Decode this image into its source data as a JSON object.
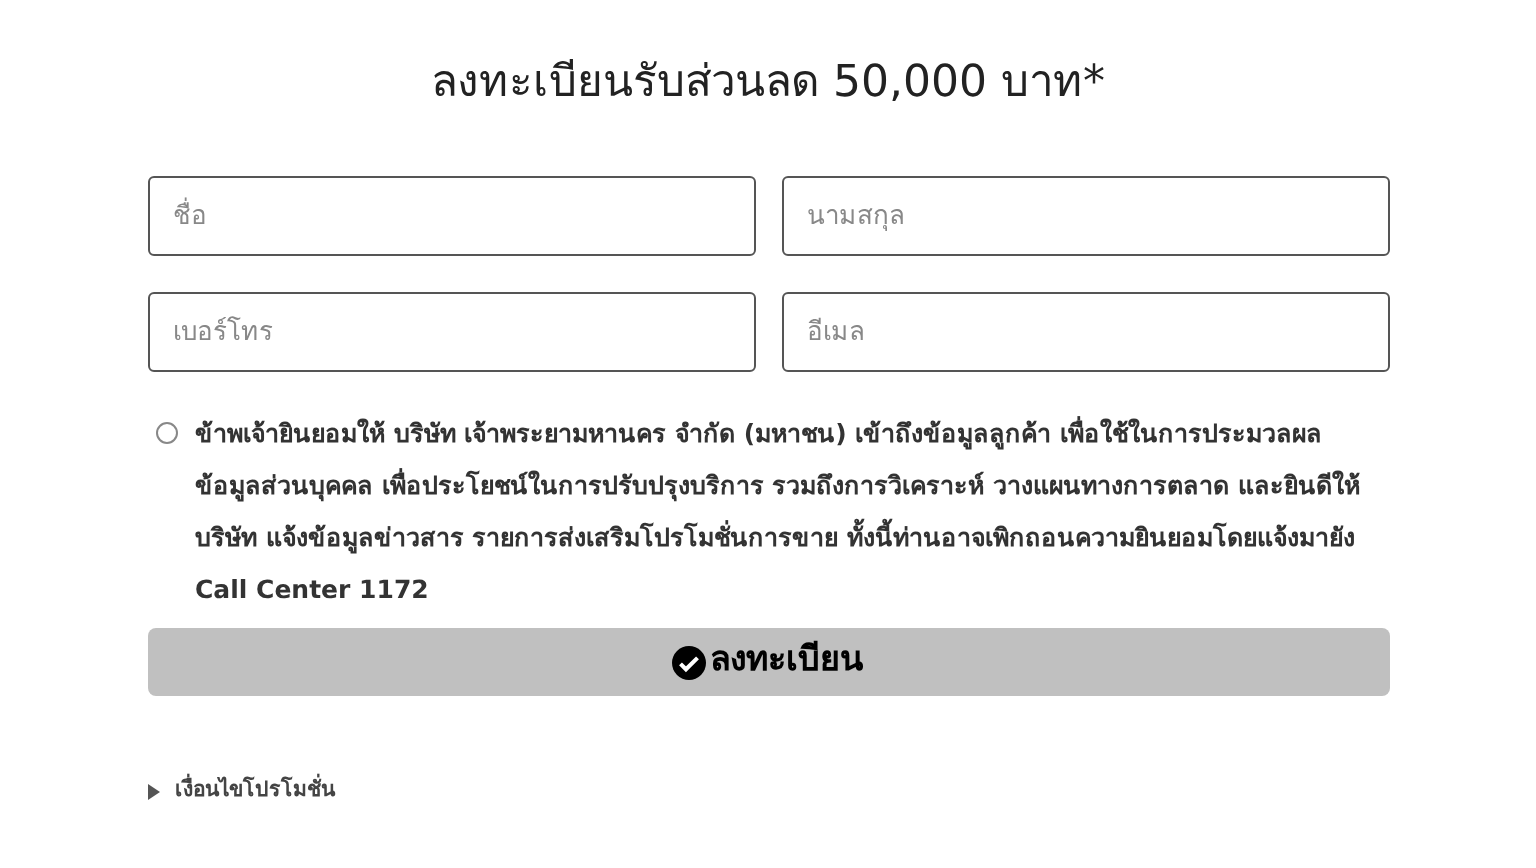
{
  "title": "ลงทะเบียนรับส่วนลด 50,000 บาท*",
  "fields": [
    {
      "placeholder": "ชื่อ"
    },
    {
      "placeholder": "นามสกุล"
    },
    {
      "placeholder": "เบอร์โทร"
    },
    {
      "placeholder": "อีเมล"
    }
  ],
  "consent": {
    "checked": false,
    "text": "ข้าพเจ้ายินยอมให้ บริษัท เจ้าพระยามหานคร จำกัด (มหาชน) เข้าถึงข้อมูลลูกค้า เพื่อใช้ในการประมวลผล ข้อมูลส่วนบุคคล เพื่อประโยชน์ในการปรับปรุงบริการ รวมถึงการวิเคราะห์ วางแผนทางการตลาด และยินดีให้ บริษัท แจ้งข้อมูลข่าวสาร รายการส่งเสริมโปรโมชั่นการขาย ทั้งนี้ท่านอาจเพิกถอนความยินยอมโดยแจ้งมายัง Call Center 1172"
  },
  "submit_button": {
    "label": "ลงทะเบียน"
  },
  "conditions": {
    "label": "เงื่อนไขโปรโมชั่น",
    "expanded": false
  }
}
